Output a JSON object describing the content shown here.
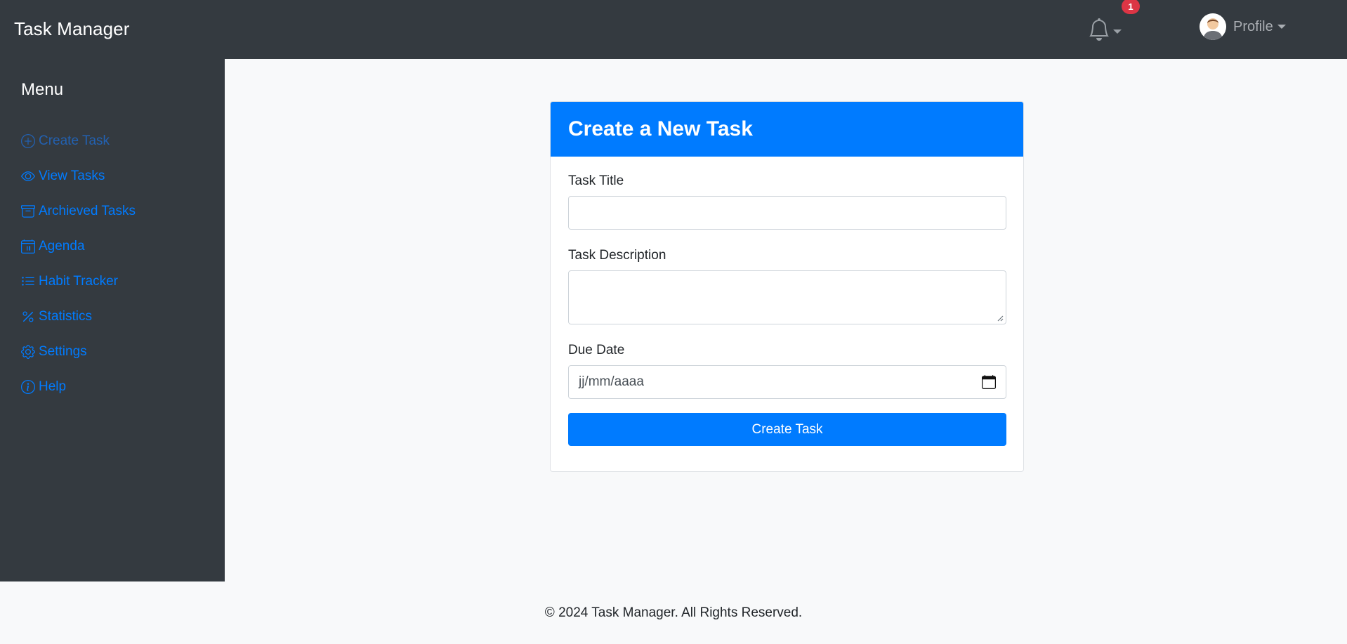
{
  "navbar": {
    "brand": "Task Manager",
    "notifications": {
      "count": "1",
      "icon": "bell-icon"
    },
    "profile": {
      "label": "Profile",
      "icon": "avatar"
    }
  },
  "sidebar": {
    "title": "Menu",
    "items": [
      {
        "label": "Create Task",
        "icon": "plus-circle-icon",
        "active": true
      },
      {
        "label": "View Tasks",
        "icon": "eye-icon"
      },
      {
        "label": "Archieved Tasks",
        "icon": "archive-icon"
      },
      {
        "label": "Agenda",
        "icon": "calendar-icon"
      },
      {
        "label": "Habit Tracker",
        "icon": "list-icon"
      },
      {
        "label": "Statistics",
        "icon": "percent-icon"
      },
      {
        "label": "Settings",
        "icon": "gear-icon"
      },
      {
        "label": "Help",
        "icon": "info-circle-icon"
      }
    ]
  },
  "form": {
    "title": "Create a New Task",
    "task_title_label": "Task Title",
    "task_title_value": "",
    "task_description_label": "Task Description",
    "task_description_value": "",
    "due_date_label": "Due Date",
    "due_date_placeholder": "jj/mm/aaaa",
    "submit_label": "Create Task"
  },
  "footer": {
    "text": "© 2024 Task Manager. All Rights Reserved."
  },
  "colors": {
    "navbar": "#343a40",
    "primary": "#007bff",
    "badge": "#dc3545",
    "background": "#f8f9fa"
  }
}
